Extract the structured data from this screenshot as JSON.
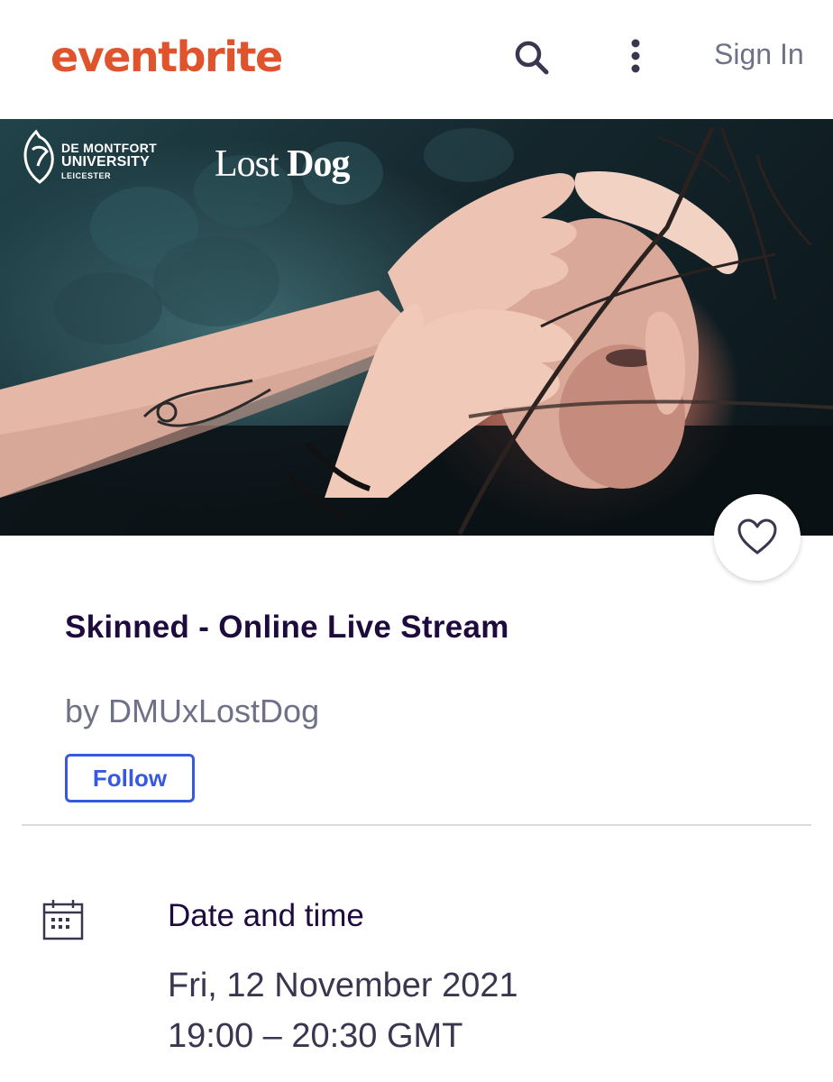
{
  "header": {
    "logo_text": "eventbrite",
    "search_icon": "search-icon",
    "more_icon": "more-vertical-icon",
    "sign_in_label": "Sign In"
  },
  "hero": {
    "image": "performance-photo",
    "partner_logos": {
      "dmu_line1": "DE MONTFORT",
      "dmu_line2": "UNIVERSITY",
      "dmu_line3": "LEICESTER",
      "lostdog_lost": "Lost ",
      "lostdog_dog": "Dog"
    },
    "like_icon": "heart-icon"
  },
  "event": {
    "title": "Skinned - Online Live Stream",
    "organizer": "by DMUxLostDog",
    "follow_label": "Follow"
  },
  "date_time": {
    "icon": "calendar-icon",
    "label": "Date and time",
    "date": "Fri, 12 November 2021",
    "time": "19:00 – 20:30 GMT"
  },
  "colors": {
    "brand": "#e0542d",
    "title": "#1e0a3c",
    "muted": "#6f7287",
    "link": "#3659e3"
  }
}
